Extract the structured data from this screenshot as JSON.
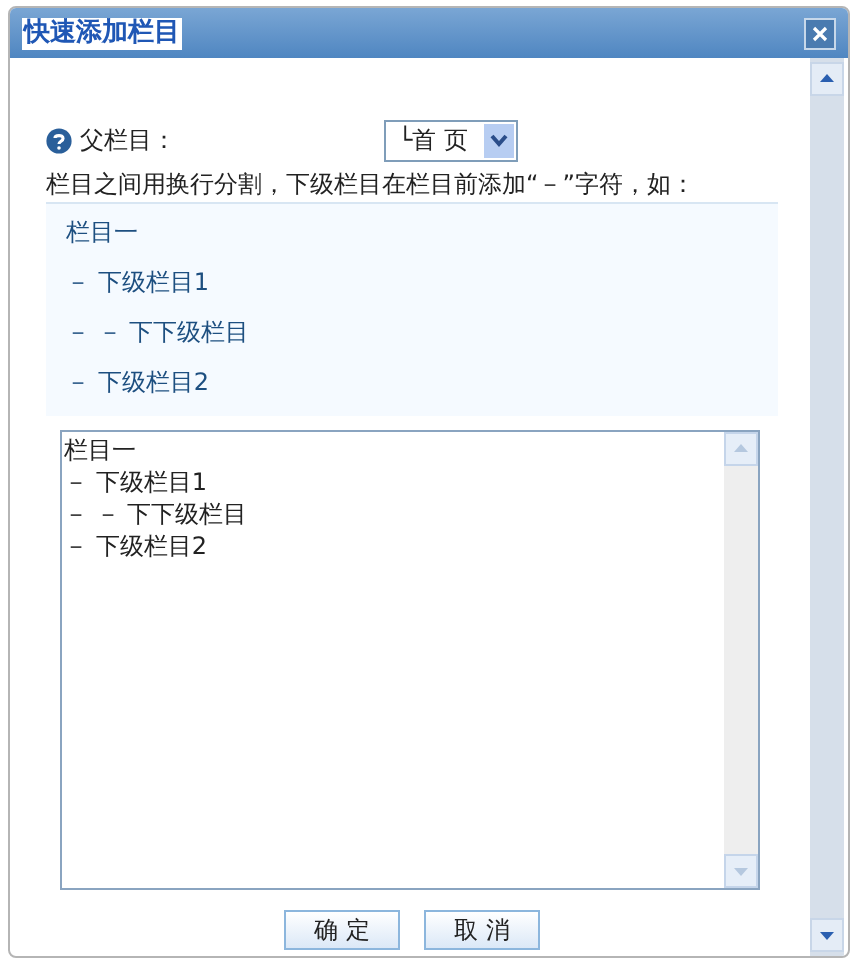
{
  "window": {
    "title": "快速添加栏目"
  },
  "parent": {
    "label": "父栏目：",
    "value": "└首 页"
  },
  "hint": "栏目之间用换行分割，下级栏目在栏目前添加“－”字符，如：",
  "example_lines": [
    "栏目一",
    "－ 下级栏目1",
    "－ － 下下级栏目",
    "－ 下级栏目2"
  ],
  "textarea_lines": [
    "栏目一",
    "－ 下级栏目1",
    "－ － 下下级栏目",
    "－ 下级栏目2"
  ],
  "buttons": [
    "确 定",
    "取 消"
  ]
}
